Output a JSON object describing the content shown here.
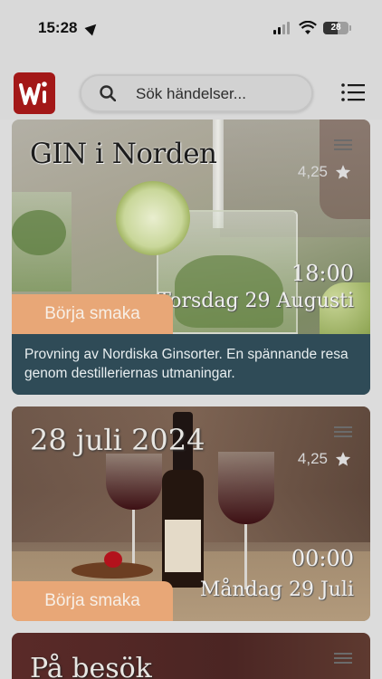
{
  "status_bar": {
    "time": "15:28",
    "battery": "28"
  },
  "header": {
    "search_placeholder": "Sök händelser..."
  },
  "events": [
    {
      "title": "GIN i Norden",
      "rating": "4,25",
      "time": "18:00",
      "date": "Torsdag 29 Augusti",
      "cta": "Börja smaka",
      "description": "Provning av Nordiska Ginsorter. En spännande resa genom destilleriernas utmaningar."
    },
    {
      "title": "28 juli 2024",
      "rating": "4,25",
      "time": "00:00",
      "date": "Måndag 29 Juli",
      "cta": "Börja smaka"
    },
    {
      "title": "På besök"
    }
  ],
  "colors": {
    "brand": "#a31818",
    "cta": "#e8a777",
    "description_bg": "#2f4b57"
  }
}
